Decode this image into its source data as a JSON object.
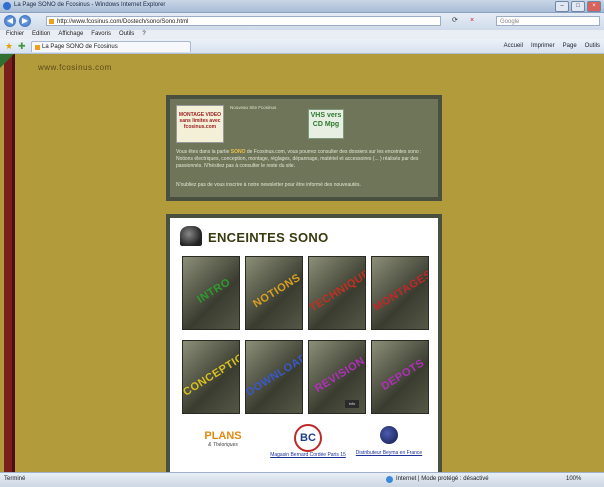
{
  "window": {
    "title": "La Page SONO de Fcosinus - Windows Internet Explorer",
    "controls": [
      "–",
      "□",
      "×"
    ]
  },
  "nav": {
    "back": "◀",
    "forward": "▶",
    "address": "http://www.fcosinus.com/Dostech/sono/Sono.html",
    "refresh": "⟳",
    "stop": "×",
    "search_placeholder": "Google"
  },
  "menu": [
    "Fichier",
    "Edition",
    "Affichage",
    "Favoris",
    "Outils",
    "?"
  ],
  "favorites": {
    "tab_label": "La Page SONO de Fcosinus",
    "tools": [
      "Accueil",
      "Imprimer",
      "Page",
      "Outils"
    ]
  },
  "page": {
    "site_name": "www.fcosinus.com",
    "info": {
      "logo1_text": "MONTAGE VIDEO sans limites avec fcosinus.com",
      "logo1_caption": "Nouveau Site Fcosinus",
      "logo2_text": "VHS vers CD Mpg",
      "paragraph_pre": "Vous êtes dans la partie ",
      "paragraph_bold": "SONO",
      "paragraph_post": " de Fcosinus.com, vous pourrez consulter des dossiers sur les enceintes sono : Notions électriques, conception, montage, réglages, dépannage, matériel et accessoires (... ) réalisés par des passionnés. N'hésitez pas à consulter le reste du site.",
      "paragraph2": "N'oubliez pas de vous inscrire à notre newsletter pour être informé des nouveautés."
    },
    "section_title": "ENCEINTES SONO",
    "tiles": [
      {
        "label": "INTRO",
        "color": "#2e9a2e"
      },
      {
        "label": "NOTIONS",
        "color": "#d8a020"
      },
      {
        "label": "TECHNIQUE",
        "color": "#c03020"
      },
      {
        "label": "MONTAGES",
        "color": "#c02828"
      },
      {
        "label": "CONCEPTION",
        "color": "#d8c020"
      },
      {
        "label": "DOWNLOAD",
        "color": "#3a58c8"
      },
      {
        "label": "REVISION",
        "color": "#b030b8"
      },
      {
        "label": "DEPOTS",
        "color": "#b030b8"
      }
    ],
    "extra_badge": "info",
    "plans_title": "PLANS",
    "plans_sub": "& Théoriques",
    "distributor1_logo": "BC",
    "distributor1": "Magasin Bernard Cordée Paris 15",
    "distributor2": "Distributeur Beyma en France"
  },
  "status": {
    "left": "Terminé",
    "zone": "Internet | Mode protégé : désactivé",
    "zoom": "100%"
  }
}
